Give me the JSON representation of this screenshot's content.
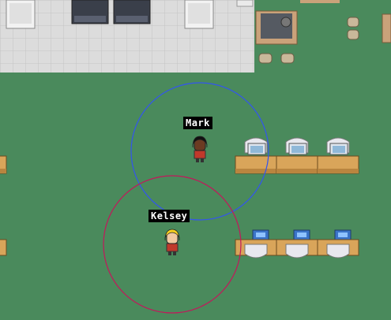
{
  "scene": {
    "floor_color": "#4a8a5c",
    "tile_floor_color": "#dcdcdc",
    "desk_color": "#d9a55a",
    "chair_color": "#e8e8ee",
    "monitor_color": "#3a74c8"
  },
  "players": [
    {
      "id": "mark",
      "name": "Mark",
      "ring_color": "#3355ee",
      "hair": "#111111",
      "skin": "#6b3b22",
      "shirt": "#c0392b"
    },
    {
      "id": "kelsey",
      "name": "Kelsey",
      "ring_color": "#c2185b",
      "hair": "#f5d020",
      "skin": "#f1c9a0",
      "shirt": "#c0392b"
    }
  ]
}
